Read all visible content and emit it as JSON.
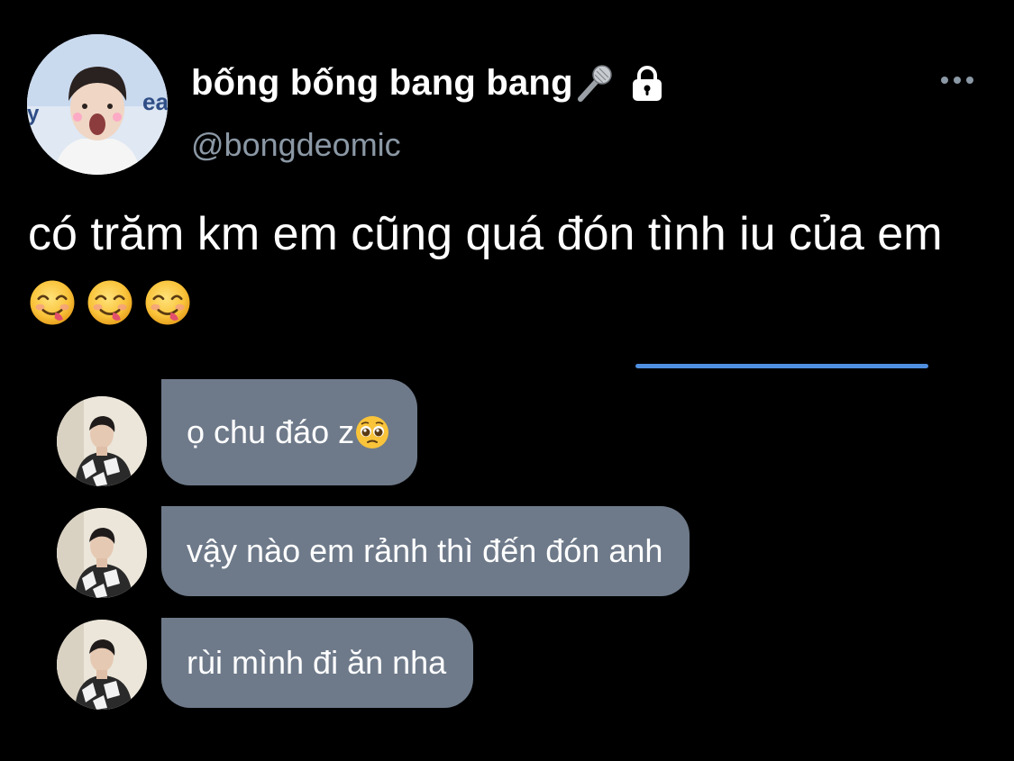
{
  "profile": {
    "display_name": "bống bống bang bang",
    "handle": "@bongdeomic",
    "avatar": "profile-photo",
    "badges": [
      "microphone-icon",
      "lock-icon"
    ]
  },
  "header": {
    "more_icon": "more-horizontal-icon"
  },
  "tweet": {
    "text": "có trăm km em cũng quá đón tình iu của em",
    "emojis": [
      "face-savoring-food",
      "face-savoring-food",
      "face-savoring-food"
    ]
  },
  "messages": [
    {
      "text": "ọ chu đáo z",
      "emoji": "pleading-face",
      "avatar": "contact-photo"
    },
    {
      "text": "vậy nào em rảnh thì đến đón anh",
      "avatar": "contact-photo"
    },
    {
      "text": "rùi mình đi ăn nha",
      "avatar": "contact-photo"
    }
  ],
  "colors": {
    "background": "#000000",
    "text_primary": "#ffffff",
    "text_secondary": "#8b98a5",
    "bubble": "#6e7a8a",
    "accent_line": "#4f8fe0"
  }
}
